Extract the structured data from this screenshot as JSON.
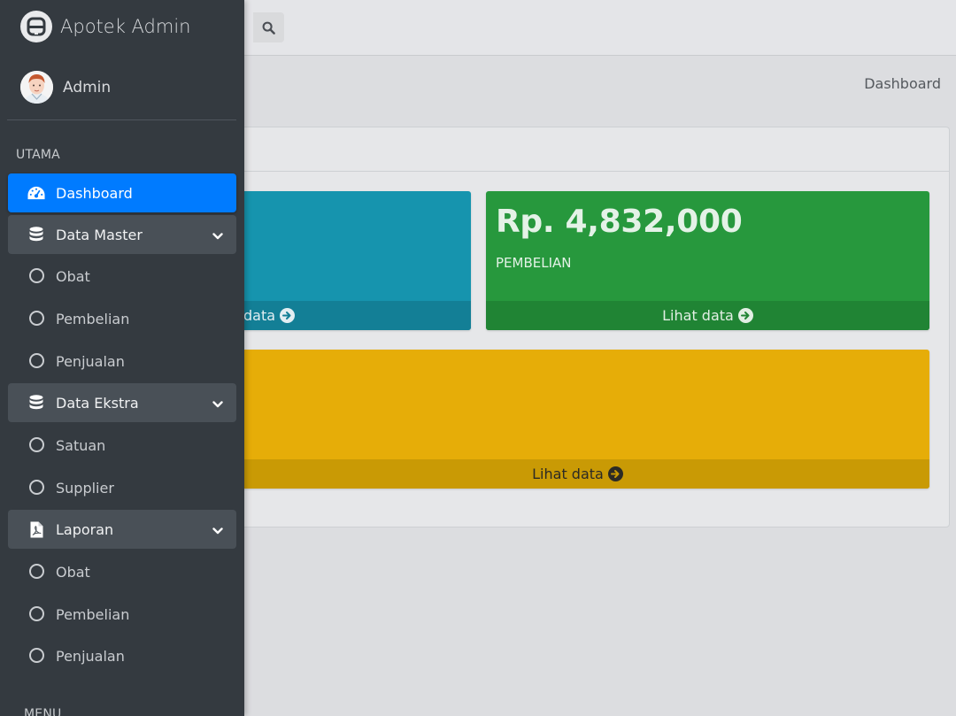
{
  "brand": {
    "name": "Apotek Admin"
  },
  "user": {
    "name": "Admin"
  },
  "breadcrumb": "Dashboard",
  "sidebar": {
    "section_main": "UTAMA",
    "dashboard": "Dashboard",
    "groups": [
      {
        "label": "Data Master",
        "items": [
          "Obat",
          "Pembelian",
          "Penjualan"
        ]
      },
      {
        "label": "Data Ekstra",
        "items": [
          "Satuan",
          "Supplier"
        ]
      },
      {
        "label": "Laporan",
        "items": [
          "Obat",
          "Pembelian",
          "Penjualan"
        ]
      }
    ],
    "section_menu": "MENU"
  },
  "boxes": {
    "teal": {
      "footer": "data"
    },
    "green": {
      "value": "Rp. 4,832,000",
      "label": "PEMBELIAN",
      "footer": "Lihat data"
    },
    "yellow": {
      "footer": "Lihat data"
    }
  },
  "colors": {
    "active": "#007bff",
    "sidebar": "#343a40",
    "teal": "#1694ae",
    "green": "#27983d",
    "yellow": "#e6ad08"
  }
}
